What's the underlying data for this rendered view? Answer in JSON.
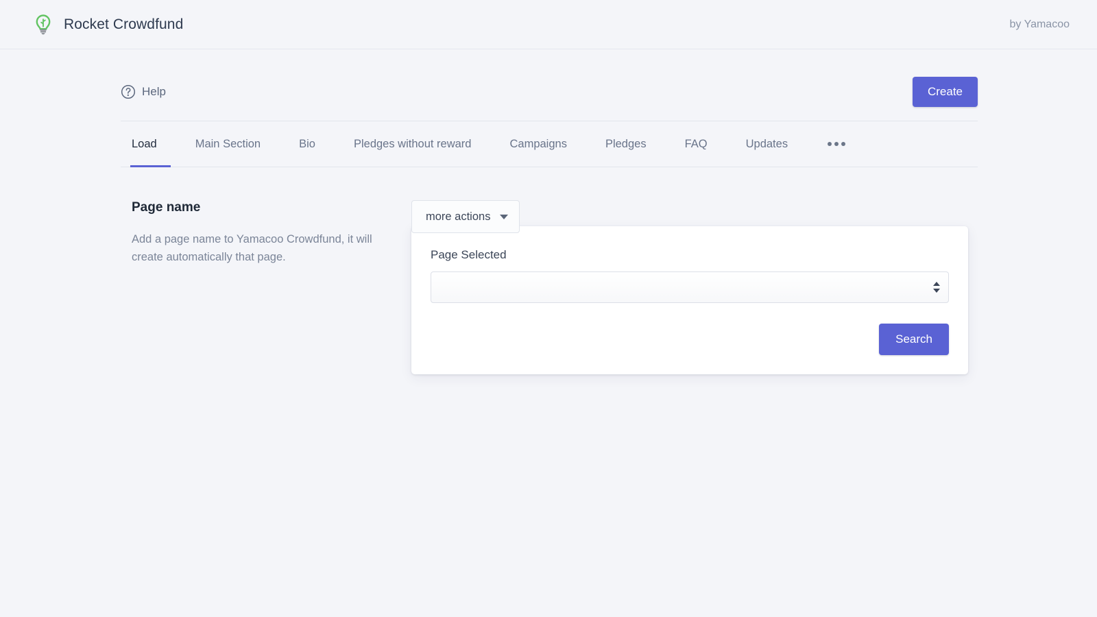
{
  "header": {
    "logo_icon": "lightbulb-icon",
    "logo_color": "#62c462",
    "title": "Rocket Crowdfund",
    "byline": "by Yamacoo"
  },
  "toolbar": {
    "help_icon": "question-circle-icon",
    "help_label": "Help",
    "create_label": "Create",
    "accent_color": "#5a62d4"
  },
  "tabs": {
    "items": [
      {
        "label": "Load",
        "active": true
      },
      {
        "label": "Main Section",
        "active": false
      },
      {
        "label": "Bio",
        "active": false
      },
      {
        "label": "Pledges without reward",
        "active": false
      },
      {
        "label": "Campaigns",
        "active": false
      },
      {
        "label": "Pledges",
        "active": false
      },
      {
        "label": "FAQ",
        "active": false
      },
      {
        "label": "Updates",
        "active": false
      }
    ],
    "overflow_icon": "ellipsis-icon"
  },
  "main": {
    "section_title": "Page name",
    "section_description": "Add a page name to Yamacoo Crowdfund, it will create automatically that page.",
    "more_actions_label": "more actions",
    "more_actions_caret_icon": "chevron-down-icon",
    "card": {
      "field_label": "Page Selected",
      "select_value": "",
      "select_placeholder": "",
      "stepper_icon": "stepper-arrows-icon",
      "search_label": "Search"
    }
  }
}
